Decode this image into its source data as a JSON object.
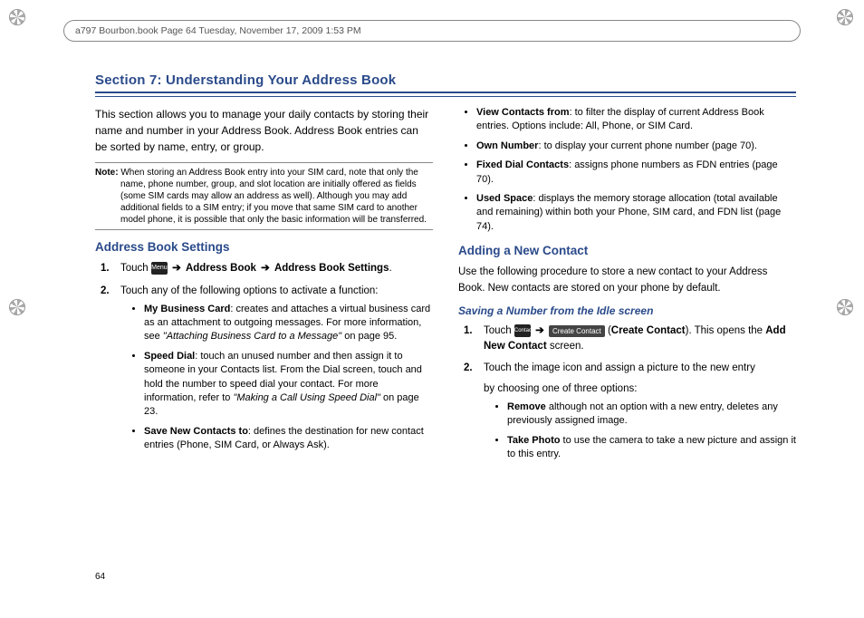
{
  "header": "a797 Bourbon.book  Page 64  Tuesday, November 17, 2009  1:53 PM",
  "section_title": "Section 7: Understanding Your Address Book",
  "intro": "This section allows you to manage your daily contacts by storing their name and number in your Address Book. Address Book entries can be sorted by name, entry, or group.",
  "note_label": "Note:",
  "note_text": "When storing an Address Book entry into your SIM card, note that only the name, phone number, group, and slot location are initially offered as fields (some SIM cards may allow an address as well). Although you may add additional fields to a SIM entry; if you move that same SIM card to another model phone, it is possible that only the basic information will be transferred.",
  "h3_settings": "Address Book Settings",
  "step1_touch": "Touch",
  "menu_key": "Menu",
  "arrow": "➔",
  "step1_ab": "Address Book",
  "step1_abs": "Address Book Settings",
  "step2": "Touch any of the following options to activate a function:",
  "bul_mbc_b": "My Business Card",
  "bul_mbc_t": ": creates and attaches a virtual business card as an attachment to outgoing messages. For more information, see ",
  "bul_mbc_i": "\"Attaching Business Card to a Message\"",
  "bul_mbc_p": " on page 95.",
  "bul_sd_b": "Speed Dial",
  "bul_sd_t": ": touch an unused number and then assign it to someone in your Contacts list. From the Dial screen, touch and hold the number to speed dial your contact. For more information, refer to ",
  "bul_sd_i": "\"Making a Call Using Speed Dial\"",
  "bul_sd_p": "  on page 23.",
  "bul_snc_b": "Save New Contacts to",
  "bul_snc_t": ": defines the destination for new contact entries (Phone, SIM Card, or Always Ask).",
  "bul_vcf_b": "View Contacts from",
  "bul_vcf_t": ": to filter the display of current Address Book entries. Options include: All, Phone, or SIM Card.",
  "bul_own_b": "Own Number",
  "bul_own_t": ": to display your current phone number (page 70).",
  "bul_fdc_b": "Fixed Dial Contacts",
  "bul_fdc_t": ": assigns phone numbers as FDN entries (page 70).",
  "bul_us_b": "Used Space",
  "bul_us_t": ": displays the memory storage allocation (total available and remaining) within both your Phone, SIM card, and FDN list (page 74).",
  "h3_add": "Adding a New Contact",
  "add_intro": "Use the following procedure to store a new contact to your Address Book. New contacts are stored on your phone by default.",
  "h4_idle": "Saving a Number from the Idle screen",
  "r_step1_touch": "Touch",
  "contacts_key": "Contacts",
  "create_chip": "Create Contact",
  "r_step1_paren": "Create Contact",
  "r_step1_rest1": ". This opens the ",
  "r_step1_addnew": "Add New Contact",
  "r_step1_rest2": " screen.",
  "r_step2a": "Touch the image icon and assign a picture to the new entry",
  "r_step2b": "by choosing one of three options:",
  "bul_rm_b": "Remove",
  "bul_rm_t": " although not an option with a new entry, deletes any previously assigned image.",
  "bul_tp_b": "Take Photo",
  "bul_tp_t": " to use the camera to take a new picture and assign it to this entry.",
  "page_number": "64"
}
